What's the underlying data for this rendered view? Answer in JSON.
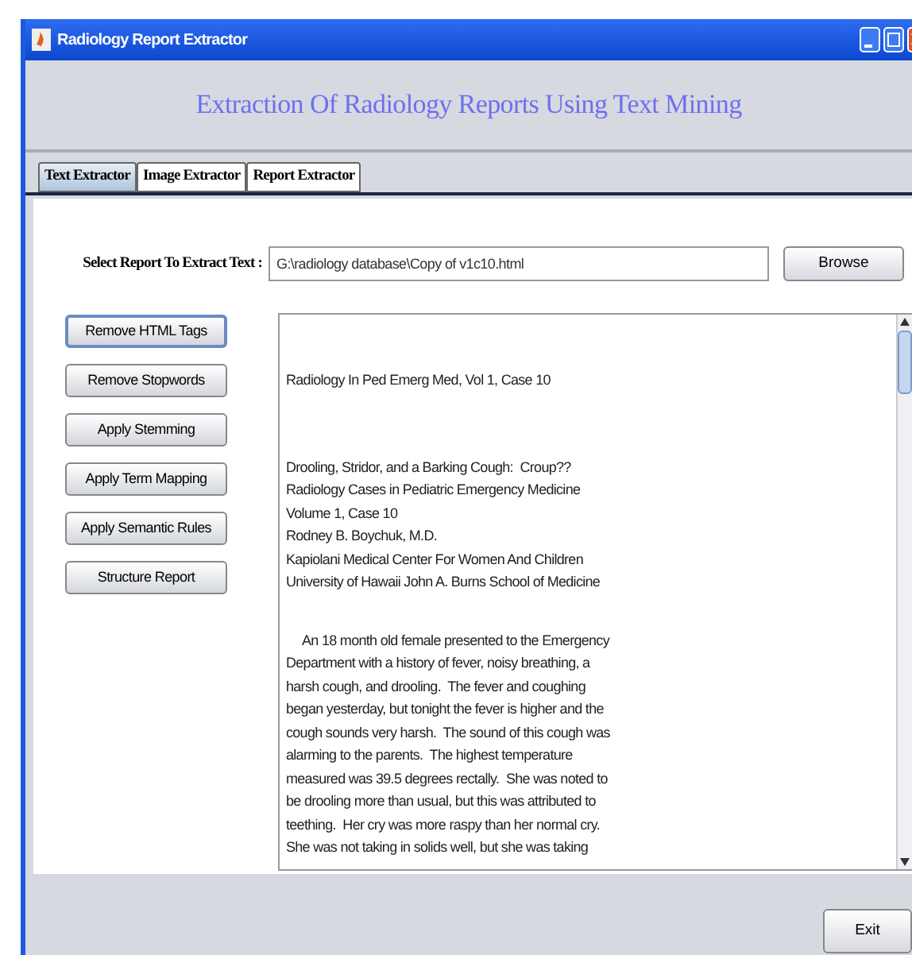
{
  "window": {
    "title": "Radiology Report Extractor"
  },
  "heading": "Extraction Of Radiology Reports Using Text Mining",
  "tabs": [
    {
      "label": "Text Extractor",
      "selected": true
    },
    {
      "label": "Image Extractor",
      "selected": false
    },
    {
      "label": "Report Extractor",
      "selected": false
    }
  ],
  "file_row": {
    "label": "Select Report To Extract Text :",
    "value": "G:\\radiology database\\Copy of v1c10.html",
    "button": "Browse"
  },
  "actions": [
    {
      "label": "Remove HTML Tags",
      "focused": true
    },
    {
      "label": "Remove Stopwords",
      "focused": false
    },
    {
      "label": "Apply Stemming",
      "focused": false
    },
    {
      "label": "Apply Term Mapping",
      "focused": false
    },
    {
      "label": "Apply Semantic Rules",
      "focused": false
    },
    {
      "label": "Structure Report",
      "focused": false
    }
  ],
  "report_text": [
    {
      "kind": "header",
      "lines": [
        "Radiology In Ped Emerg Med, Vol 1, Case 10"
      ]
    },
    {
      "kind": "header",
      "lines": [
        "Drooling, Stridor, and a Barking Cough:  Croup??",
        "Radiology Cases in Pediatric Emergency Medicine",
        "Volume 1, Case 10",
        "Rodney B. Boychuk, M.D.",
        "Kapiolani Medical Center For Women And Children",
        "University of Hawaii John A. Burns School of Medicine"
      ]
    },
    {
      "kind": "paragraph",
      "lines": [
        "An 18 month old female presented to the Emergency",
        "Department with a history of fever, noisy breathing, a",
        "harsh cough, and drooling.  The fever and coughing",
        "began yesterday, but tonight the fever is higher and the",
        "cough sounds very harsh.  The sound of this cough was",
        "alarming to the parents.  The highest temperature",
        "measured was 39.5 degrees rectally.  She was noted to",
        "be drooling more than usual, but this was attributed to",
        "teething.  Her cry was more raspy than her normal cry.",
        "She was not taking in solids well, but she was taking"
      ]
    }
  ],
  "footer_button": "Exit"
}
